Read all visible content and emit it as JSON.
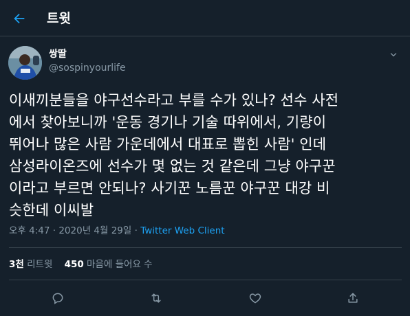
{
  "header": {
    "title": "트윗",
    "back_icon": "arrow-left-icon"
  },
  "author": {
    "display_name": "쌍딸",
    "handle": "@sospinyourlife"
  },
  "tweet": {
    "lines": [
      "이새끼분들을 야구선수라고 부를 수가 있나? 선수 사전",
      "에서 찾아보니까 '운동 경기나 기술 따위에서, 기량이",
      "뛰어나 많은 사람 가운데에서 대표로 뽑힌 사람' 인데",
      "삼성라이온즈에 선수가 몇 없는 것 같은데 그냥 야구꾼",
      "이라고 부르면 안되나? 사기꾼 노름꾼 야구꾼 대강 비",
      "슷한데 이씨발"
    ],
    "time": "오후 4:47",
    "separator": "·",
    "date": "2020년 4월 29일",
    "client": "Twitter Web Client"
  },
  "stats": {
    "retweet_count": "3천",
    "retweet_label": "리트윗",
    "like_count": "450",
    "like_label": "마음에 들어요 수"
  },
  "actions": [
    "reply-icon",
    "retweet-icon",
    "like-icon",
    "share-icon"
  ],
  "colors": {
    "background": "#15202b",
    "accent": "#1da1f2",
    "secondary_text": "#8899a6",
    "divider": "#38444d"
  }
}
